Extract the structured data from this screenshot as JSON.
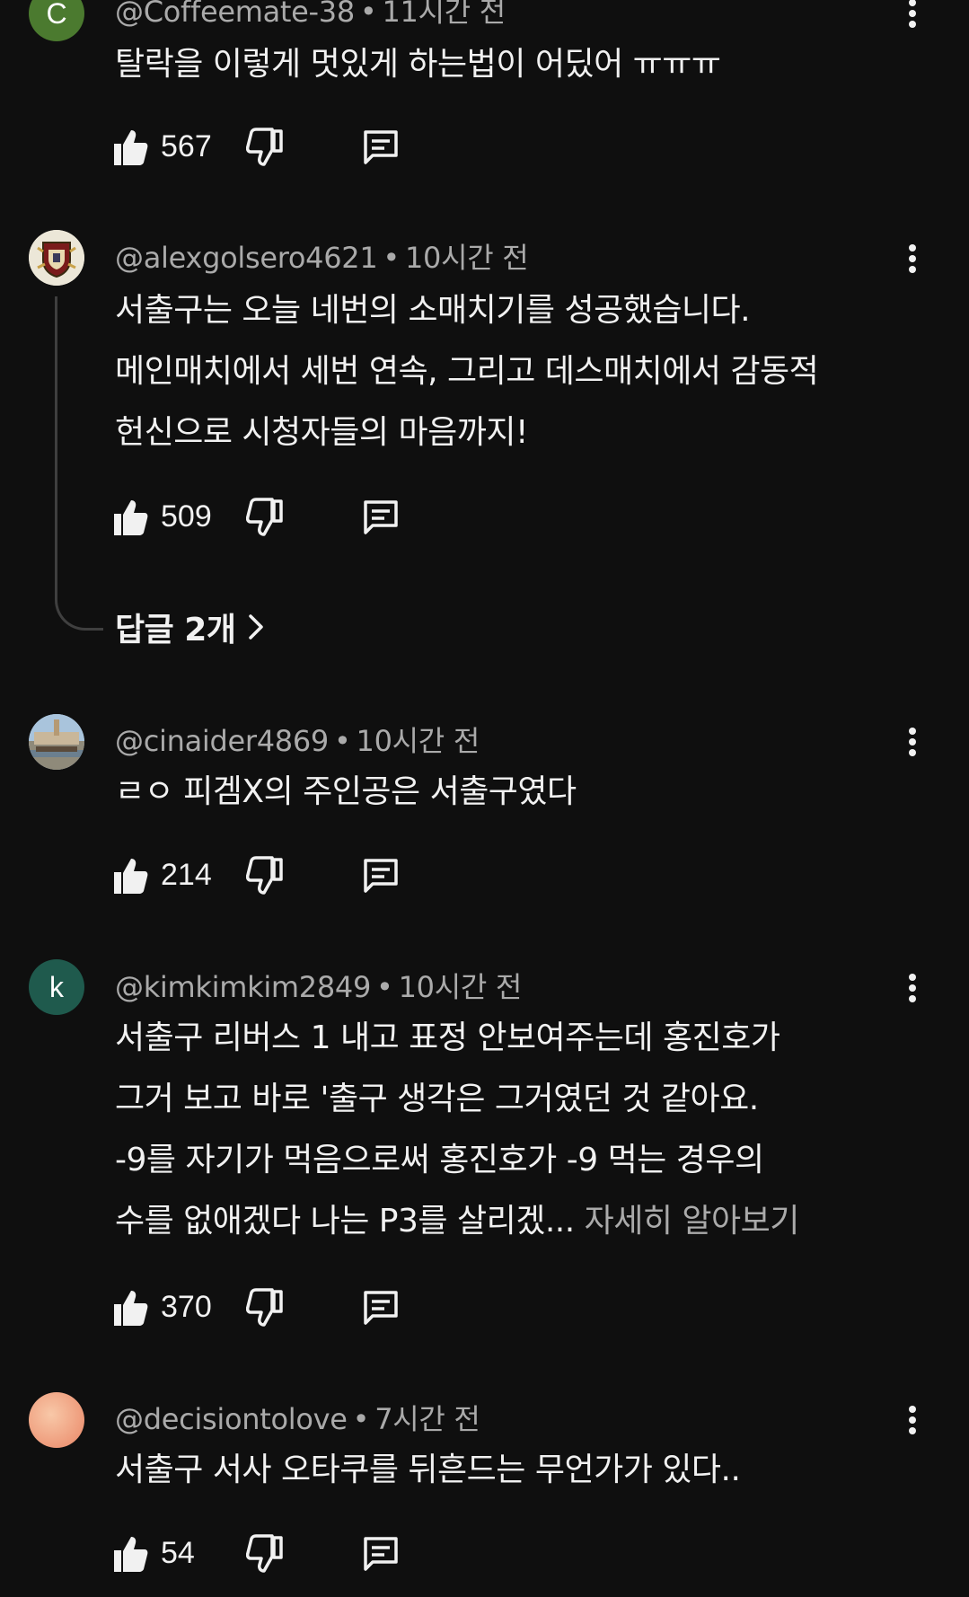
{
  "comments": [
    {
      "author": "@Coffeemate-38",
      "time": "11시간 전",
      "avatar_letter": "C",
      "avatar_color": "#4b7a2f",
      "lines": [
        "탈락을 이렇게 멋있게 하는법이 어딨어 ㅠㅠㅠ"
      ],
      "likes": "567"
    },
    {
      "author": "@alexgolsero4621",
      "time": "10시간 전",
      "avatar_letter": "",
      "avatar_color": "#e9e4d6",
      "lines": [
        "서출구는 오늘 네번의 소매치기를 성공했습니다.",
        "메인매치에서 세번 연속, 그리고 데스매치에서 감동적",
        "헌신으로 시청자들의 마음까지!"
      ],
      "likes": "509",
      "replies": "답글 2개"
    },
    {
      "author": "@cinaider4869",
      "time": "10시간 전",
      "avatar_letter": "",
      "avatar_color": "#9fb7cf",
      "lines": [
        "ㄹㅇ 피겜X의 주인공은 서출구였다"
      ],
      "likes": "214"
    },
    {
      "author": "@kimkimkim2849",
      "time": "10시간 전",
      "avatar_letter": "k",
      "avatar_color": "#1f5a4d",
      "lines": [
        "서출구 리버스 1 내고 표정 안보여주는데 홍진호가",
        "그거 보고 바로 '출구 생각은 그거였던 것 같아요.",
        "-9를 자기가 먹음으로써 홍진호가 -9 먹는 경우의",
        "수를 없애겠다 나는 P3를 살리겠..."
      ],
      "more": "자세히 알아보기",
      "likes": "370"
    },
    {
      "author": "@decisiontolove",
      "time": "7시간 전",
      "avatar_letter": "",
      "avatar_color": "#f2a98a",
      "lines": [
        "서출구 서사 오타쿠를 뒤흔드는 무언가가 있다.."
      ],
      "likes": "54"
    }
  ],
  "icons": {
    "like": "thumbs-up-icon",
    "dislike": "thumbs-down-icon",
    "reply": "reply-comment-icon",
    "menu": "more-vert-icon",
    "chevron": "chevron-right-icon"
  }
}
